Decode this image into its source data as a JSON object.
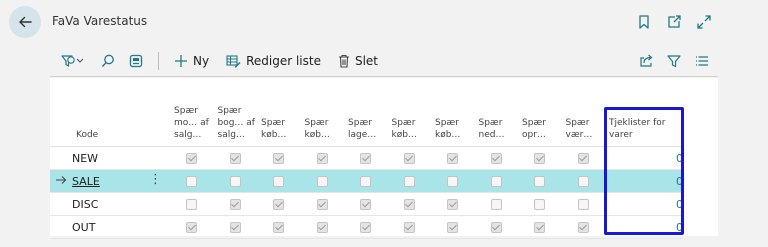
{
  "page": {
    "title": "FaVa Varestatus"
  },
  "header_icons": [
    "bookmark-icon",
    "open-new-window-icon",
    "expand-icon"
  ],
  "toolbar": {
    "new_label": "Ny",
    "edit_list_label": "Rediger liste",
    "delete_label": "Slet"
  },
  "table": {
    "col_kode": "Kode",
    "spaer_columns": [
      "Spær mo… af salg…",
      "Spær bog… af salg…",
      "Spær køb…",
      "Spær køb…",
      "Spær lage…",
      "Spær køb…",
      "Spær køb…",
      "Spær ned…",
      "Spær opr…",
      "Spær vær…"
    ],
    "col_tjek": "Tjeklister for varer",
    "rows": [
      {
        "kode": "NEW",
        "checks": [
          true,
          true,
          true,
          true,
          true,
          true,
          true,
          true,
          true,
          true
        ],
        "tjek": "0",
        "selected": false
      },
      {
        "kode": "SALE",
        "checks": [
          false,
          false,
          false,
          false,
          false,
          false,
          false,
          false,
          false,
          false
        ],
        "tjek": "0",
        "selected": true
      },
      {
        "kode": "DISC",
        "checks": [
          false,
          true,
          true,
          true,
          true,
          true,
          true,
          false,
          false,
          false
        ],
        "tjek": "0",
        "selected": false
      },
      {
        "kode": "OUT",
        "checks": [
          true,
          true,
          true,
          true,
          true,
          true,
          true,
          true,
          true,
          true
        ],
        "tjek": "0",
        "selected": false
      }
    ]
  },
  "colors": {
    "accent": "#1f7a87",
    "selected_row": "#a9e4e8",
    "highlight_box": "#1a16d6"
  }
}
